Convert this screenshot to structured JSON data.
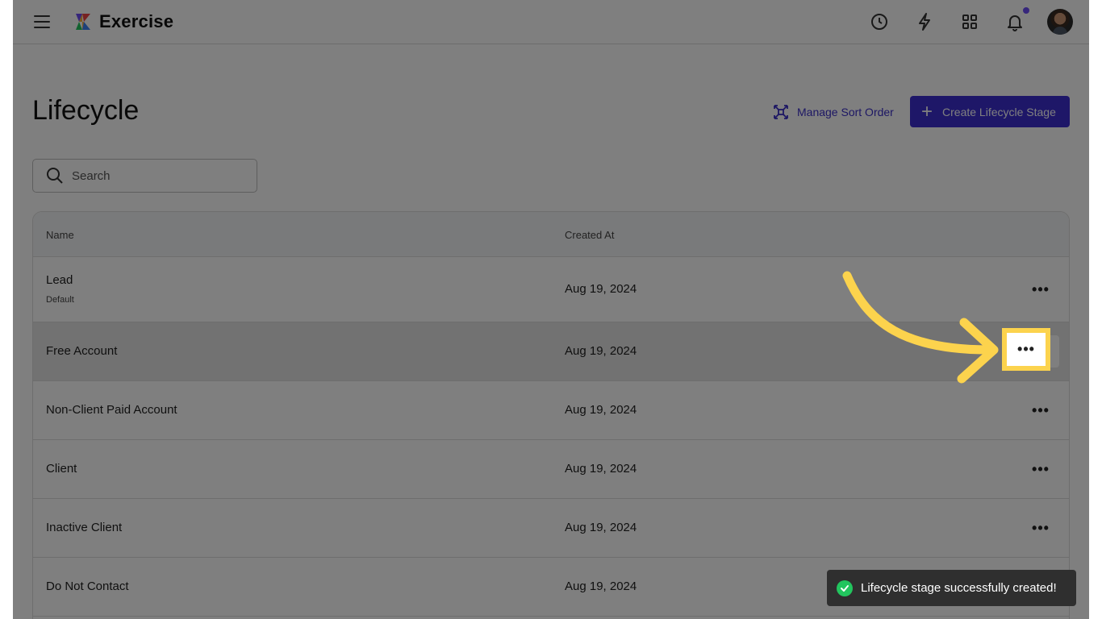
{
  "topbar": {
    "app_title": "Exercise",
    "icons": [
      "menu-icon",
      "clock-icon",
      "lightning-icon",
      "apps-grid-icon",
      "bell-icon"
    ]
  },
  "header": {
    "title": "Lifecycle",
    "manage_sort_label": "Manage Sort Order",
    "create_label": "Create Lifecycle Stage"
  },
  "search": {
    "placeholder": "Search"
  },
  "table": {
    "columns": {
      "name": "Name",
      "created_at": "Created At"
    },
    "rows": [
      {
        "name": "Lead",
        "sub": "Default",
        "created": "Aug 19, 2024",
        "actions": "•••"
      },
      {
        "name": "Free Account",
        "created": "Aug 19, 2024",
        "actions": "•••"
      },
      {
        "name": "Non-Client Paid Account",
        "created": "Aug 19, 2024",
        "actions": "•••"
      },
      {
        "name": "Client",
        "created": "Aug 19, 2024",
        "actions": "•••"
      },
      {
        "name": "Inactive Client",
        "created": "Aug 19, 2024",
        "actions": "•••"
      },
      {
        "name": "Do Not Contact",
        "created": "Aug 19, 2024",
        "actions": "•••"
      }
    ]
  },
  "toast": {
    "message": "Lifecycle stage successfully created!"
  },
  "colors": {
    "accent": "#3d2fd1",
    "highlight": "#fcd34d",
    "success": "#22c55e"
  }
}
